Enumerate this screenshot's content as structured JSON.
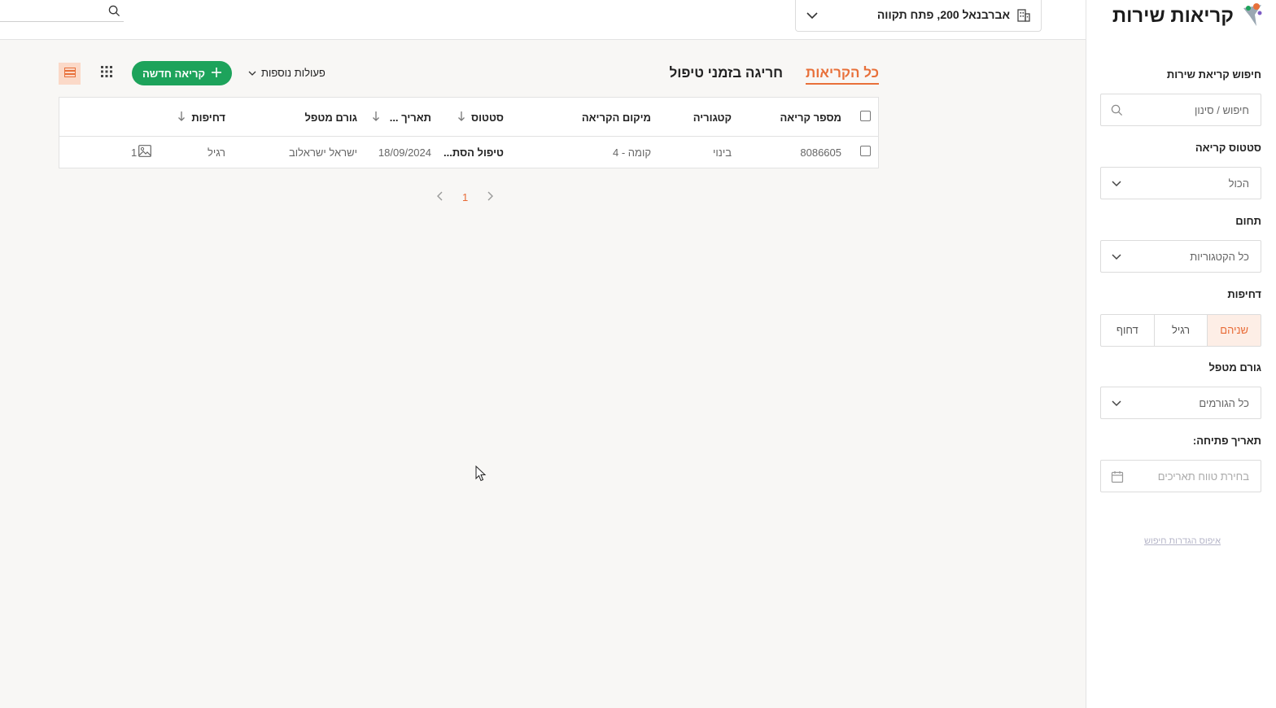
{
  "app": {
    "title": "קריאות שירות"
  },
  "header": {
    "location": "אברבנאל 200, פתח תקווה",
    "search_placeholder": ""
  },
  "sidebar": {
    "search_label": "חיפוש קריאת שירות",
    "search_placeholder": "חיפוש / סינון",
    "status_label": "סטטוס קריאה",
    "status_value": "הכול",
    "domain_label": "תחום",
    "domain_value": "כל הקטגוריות",
    "urgency_label": "דחיפות",
    "urgency_options": [
      "שניהם",
      "רגיל",
      "דחוף"
    ],
    "urgency_selected": "שניהם",
    "handler_label": "גורם מטפל",
    "handler_value": "כל הגורמים",
    "date_label": "תאריך פתיחה:",
    "date_placeholder": "בחירת טווח תאריכים",
    "reset_label": "איפוס הגדרות חיפוש"
  },
  "main": {
    "tabs": [
      {
        "label": "כל הקריאות",
        "active": true
      },
      {
        "label": "חריגה בזמני טיפול",
        "active": false
      }
    ],
    "more_actions_label": "פעולות נוספות",
    "new_call_label": "קריאה חדשה"
  },
  "table": {
    "columns": [
      "מספר קריאה",
      "קטגוריה",
      "מיקום הקריאה",
      "סטטוס",
      "תאריך ...",
      "גורם מטפל",
      "דחיפות"
    ],
    "rows": [
      {
        "number": "8086605",
        "category": "בינוי",
        "location": "קומה - 4",
        "status": "טיפול הסת...",
        "date": "18/09/2024",
        "handler": "ישראל ישראלוב",
        "urgency": "רגיל",
        "images": "1"
      }
    ]
  },
  "pagination": {
    "current": "1"
  },
  "colors": {
    "accent": "#e86a35",
    "primary_button": "#1da35b"
  }
}
